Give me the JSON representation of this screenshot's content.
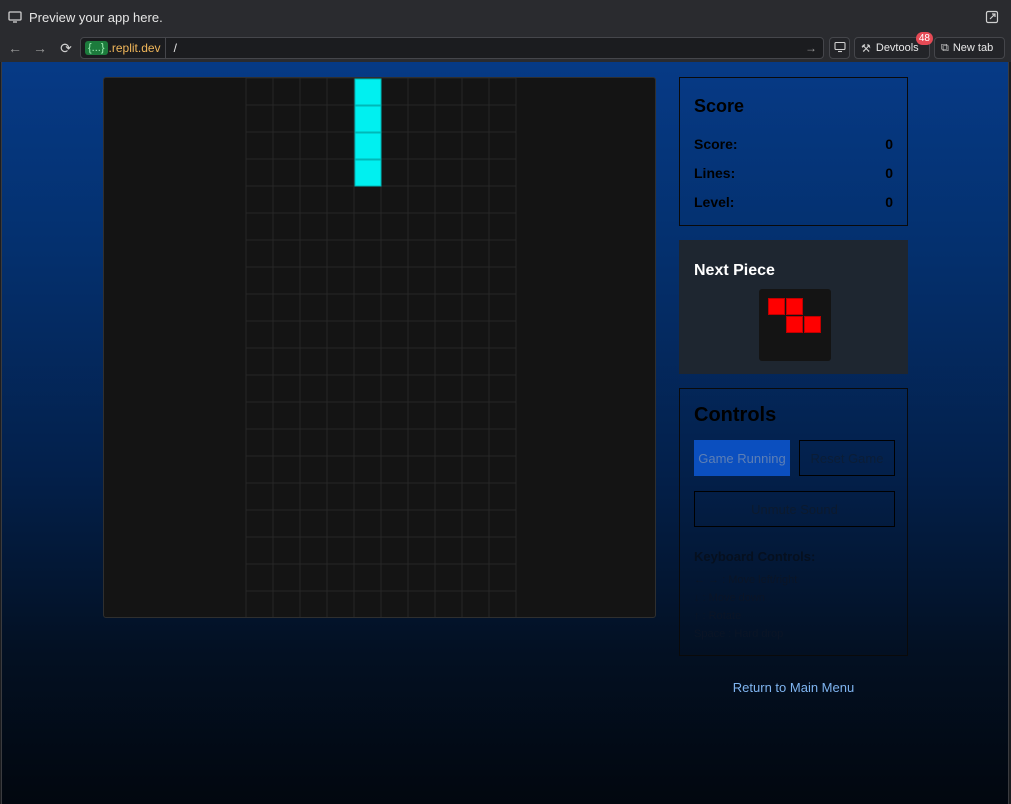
{
  "browser": {
    "title": "Preview your app here.",
    "url_badge": "{...}",
    "url_domain": ".replit.dev",
    "url_path": "/",
    "devtools_label": "Devtools",
    "devtools_count": "48",
    "new_tab_label": "New tab"
  },
  "game": {
    "board": {
      "cols": 10,
      "rows": 20
    },
    "active_piece": {
      "type": "I",
      "color": "#00f0f0",
      "cells": [
        [
          4,
          0
        ],
        [
          4,
          1
        ],
        [
          4,
          2
        ],
        [
          4,
          3
        ]
      ]
    }
  },
  "score": {
    "title": "Score",
    "rows": [
      {
        "label": "Score:",
        "value": "0"
      },
      {
        "label": "Lines:",
        "value": "0"
      },
      {
        "label": "Level:",
        "value": "0"
      }
    ]
  },
  "next_piece": {
    "title": "Next Piece",
    "type": "Z",
    "color": "#ff0000",
    "cells": [
      [
        0,
        0
      ],
      [
        1,
        0
      ],
      [
        1,
        1
      ],
      [
        2,
        1
      ]
    ]
  },
  "controls": {
    "title": "Controls",
    "running_label": "Game Running",
    "reset_label": "Reset Game",
    "mute_label": "Unmute Sound",
    "keyboard_title": "Keyboard Controls:",
    "keyboard_lines": [
      "← → : Move left/right",
      "↓ : Move down",
      "↑ : Rotate",
      "Space : Hard drop"
    ]
  },
  "return_label": "Return to Main Menu"
}
